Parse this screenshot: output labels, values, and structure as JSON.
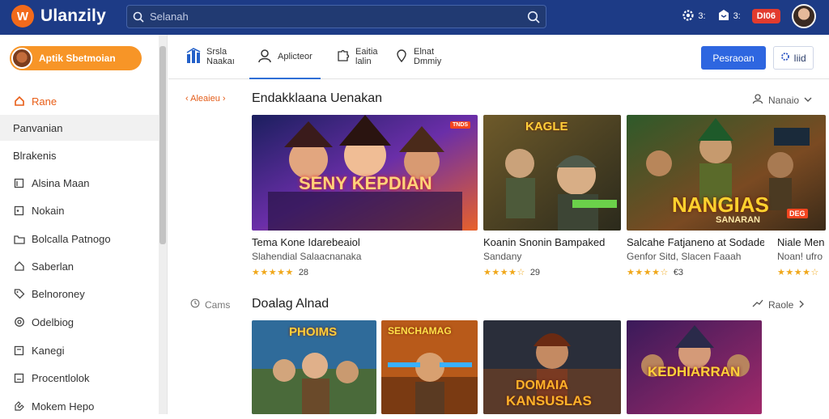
{
  "header": {
    "app_name": "Ulanzily",
    "search_placeholder": "Selanah",
    "icon_btn_1_label": "3:",
    "icon_btn_2_label": "3:",
    "badge_label": "DI06"
  },
  "sidebar": {
    "profile_label": "Aptik Sbetmoian",
    "items": [
      {
        "label": "Rane",
        "icon": "home-icon"
      },
      {
        "label": "Panvanian",
        "icon": ""
      },
      {
        "label": "Blrakenis",
        "icon": ""
      },
      {
        "label": "Alsina Maan",
        "icon": "bookmark-icon"
      },
      {
        "label": "Nokain",
        "icon": "gamepad-icon"
      },
      {
        "label": "Bolcalla Patnogo",
        "icon": "folder-icon"
      },
      {
        "label": "Saberlan",
        "icon": "house-icon"
      },
      {
        "label": "Belnoroney",
        "icon": "tag-icon"
      },
      {
        "label": "Odelbiog",
        "icon": "shield-icon"
      },
      {
        "label": "Kanegi",
        "icon": "grid-icon"
      },
      {
        "label": "Procentlolok",
        "icon": "document-icon"
      },
      {
        "label": "Mokem Hepo",
        "icon": "link-icon"
      }
    ]
  },
  "subnav": {
    "tabs": [
      {
        "line1": "Srsla",
        "line2": "Naakaı"
      },
      {
        "line1": "Aplicteor",
        "line2": ""
      },
      {
        "line1": "Eaitia",
        "line2": "lalin"
      },
      {
        "line1": "Elnat",
        "line2": "Dmmiy"
      }
    ],
    "primary_button": "Pesraoan",
    "secondary_button": "Iiid"
  },
  "section1": {
    "pill": "‹ Aleaieu ›",
    "title": "Endakklaana Uenakan",
    "right_label": "Nanaio",
    "cards": [
      {
        "art_text": "SENY KEPDIAN",
        "tag": "TNDS",
        "title": "Tema Kone Idarebeaiol",
        "subtitle": "Slahendial Salaacnanaka",
        "stars": "★★★★★",
        "rating": "28"
      },
      {
        "art_text": "KAGLE",
        "tag": "",
        "title": "Koanin Snonin Bampaked",
        "subtitle": "Sandany",
        "stars": "★★★★☆",
        "rating": "29"
      },
      {
        "art_text": "NANGIAS",
        "art_sub": "SANARAN",
        "tag": "DEG",
        "title": "Salcahe Fatjaneno at Sodade",
        "subtitle": "Genfor Sitd, Slacen Faaah",
        "stars": "★★★★☆",
        "rating": "€3"
      },
      {
        "art_text": "",
        "tag": "",
        "title": "Niale Men",
        "subtitle": "Noan! ufro",
        "stars": "★★★★☆",
        "rating": ""
      }
    ]
  },
  "section2": {
    "side_label": "Cams",
    "title": "Doalag Alnad",
    "right_label": "Raole",
    "cards": [
      {
        "art_text": "PHOIMS"
      },
      {
        "art_text": "SENCHAMAG"
      },
      {
        "art_text": "DOMAIA",
        "art_sub": "KANSUSLAS"
      },
      {
        "art_text": "KEDHIARRAN"
      }
    ]
  },
  "colors": {
    "topbar": "#1d3b86",
    "accent_orange": "#f79527",
    "primary_blue": "#2e66e0",
    "star": "#f0a81c"
  }
}
